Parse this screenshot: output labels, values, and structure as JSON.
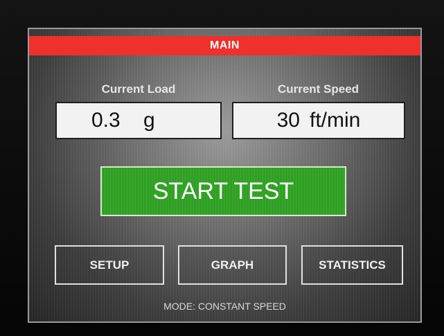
{
  "header": {
    "title": "MAIN"
  },
  "load": {
    "label": "Current Load",
    "value": "0.3",
    "unit": "g"
  },
  "speed": {
    "label": "Current Speed",
    "value": "30",
    "unit": "ft/min"
  },
  "start": {
    "label": "START TEST"
  },
  "nav": {
    "setup": "SETUP",
    "graph": "GRAPH",
    "statistics": "STATISTICS"
  },
  "status": {
    "mode": "MODE: CONSTANT SPEED"
  },
  "colors": {
    "title_bar": "#f0302a",
    "start_button": "#2fa023",
    "value_box": "#f2f2f2"
  }
}
